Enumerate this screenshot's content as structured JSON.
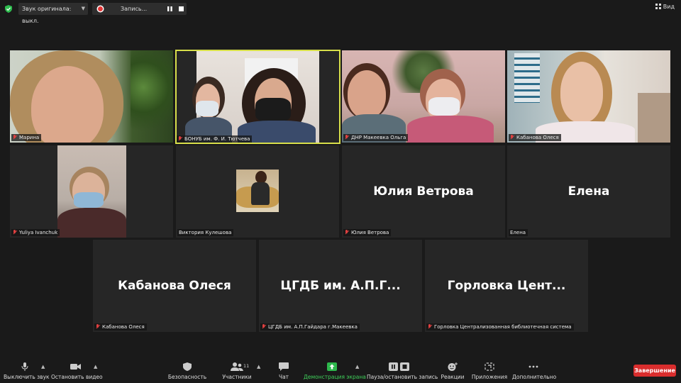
{
  "topbar": {
    "audio_label": "Звук оригинала: выкл.",
    "record_label": "Запись...",
    "view_label": "Вид"
  },
  "tiles": [
    {
      "name": "Марина"
    },
    {
      "name": "БОНУБ им. Ф. И. Тютчева"
    },
    {
      "name": "ДНР Макеевка Ольга"
    },
    {
      "name": "Кабанова Олеся"
    },
    {
      "name": "Yuliya Ivanchuk"
    },
    {
      "name": "Виктория Кулешова"
    },
    {
      "name": "Юлия Ветрова",
      "display": "Юлия Ветрова"
    },
    {
      "name": "Елена",
      "display": "Елена"
    },
    {
      "name": "Кабанова Олеся",
      "display": "Кабанова Олеся"
    },
    {
      "name": "ЦГДБ им. А.П.Гайдара г.Макеевка",
      "display": "ЦГДБ им. А.П.Г..."
    },
    {
      "name": "Горловка Централизованная библиотечная система",
      "display": "Горловка  Цент..."
    }
  ],
  "toolbar": {
    "mute": "Выключить звук",
    "video": "Остановить видео",
    "security": "Безопасность",
    "participants": "Участники",
    "participants_count": "11",
    "chat": "Чат",
    "share": "Демонстрация экрана",
    "record": "Пауза/остановить запись",
    "reactions": "Реакции",
    "apps": "Приложения",
    "more": "Дополнительно",
    "end": "Завершение"
  },
  "colors": {
    "active_speaker": "#d8df4a",
    "end_button": "#d92d2d",
    "share_green": "#3fcf5a",
    "mute_red": "#e04040"
  }
}
